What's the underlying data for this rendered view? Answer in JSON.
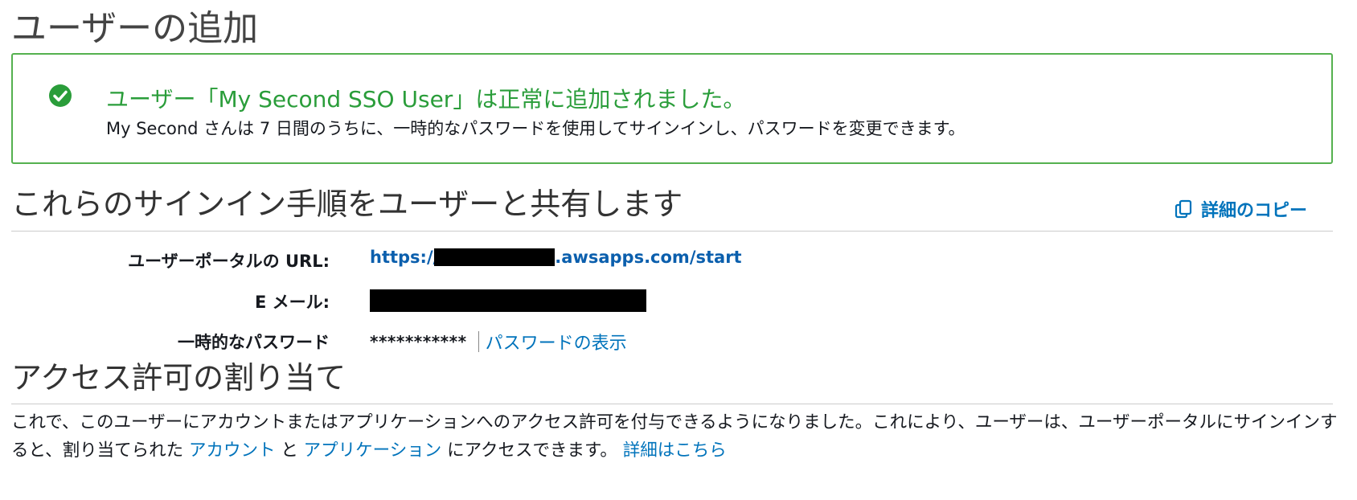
{
  "page": {
    "title": "ユーザーの追加"
  },
  "alert": {
    "icon": "check-circle-icon",
    "title": "ユーザー「My Second SSO User」は正常に追加されました。",
    "body": "My Second さんは 7 日間のうちに、一時的なパスワードを使用してサインインし、パスワードを変更できます。"
  },
  "signin": {
    "heading": "これらのサインイン手順をユーザーと共有します",
    "copy_label": "詳細のコピー",
    "portal_url_label": "ユーザーポータルの URL:",
    "portal_url_prefix": "https://",
    "portal_url_suffix": ".awsapps.com/start",
    "email_label": "E メール:",
    "temp_password_label": "一時的なパスワード",
    "temp_password_mask": "***********",
    "show_password_label": "パスワードの表示"
  },
  "access": {
    "heading": "アクセス許可の割り当て",
    "text_1": "これで、このユーザーにアカウントまたはアプリケーションへのアクセス許可を付与できるようになりました。これにより、ユーザーは、ユーザーポータルにサインインすると、割り当てられた ",
    "link_accounts": "アカウント",
    "text_2": " と ",
    "link_applications": "アプリケーション",
    "text_3": " にアクセスできます。 ",
    "link_learn_more": "詳細はこちら"
  },
  "colors": {
    "success": "#2a9d3a",
    "success_border": "#55b14f",
    "link": "#0073bb"
  }
}
